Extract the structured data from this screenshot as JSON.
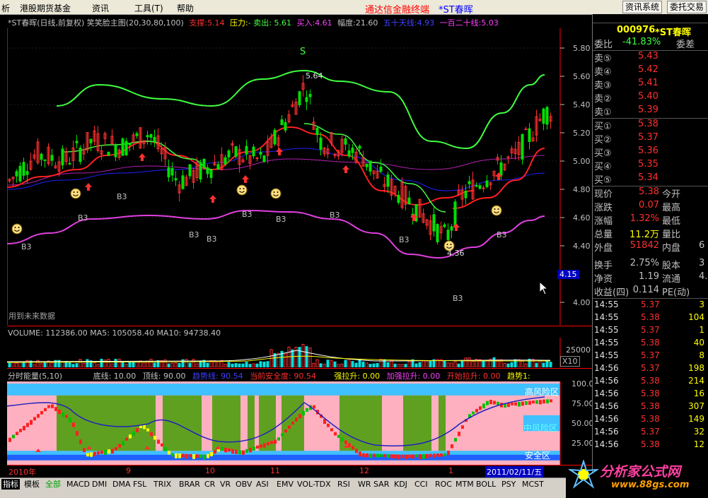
{
  "menubar": {
    "items": [
      "析",
      "港股期货基金",
      "资讯",
      "工具(T)",
      "帮助"
    ],
    "brand": "通达信金融终端",
    "stock_title": "*ST春晖",
    "btn_news": "资讯系统",
    "btn_trade": "委托交易"
  },
  "main_chart": {
    "title": "*ST春晖(日线,前复权) 笑笑脸主图(20,30,80,100)",
    "support_label": "支撑:",
    "support_value": "5.14",
    "pressure_label": "压力:",
    "pressure_value": "- 卖出: 5.61",
    "buy_label": "买入:",
    "buy_value": "4.61",
    "amplitude_label": "幅度:",
    "amplitude_value": "21.60",
    "ma50_label": "五十天线:",
    "ma50_value": "4.93",
    "ma120_label": "一百二十线:",
    "ma120_value": "5.03",
    "y_ticks": [
      "5.80",
      "5.60",
      "5.40",
      "5.20",
      "5.00",
      "4.80",
      "4.60",
      "4.40",
      "4.00"
    ],
    "price_marker": "4.15",
    "high_label": "5.64",
    "low_label": "4.36",
    "s_label": "S",
    "b3_label": "B3",
    "future_note": "用到未来数据"
  },
  "volume": {
    "text": "VOLUME: 112386.00  MA5: 105058.40  MA10: 94738.40",
    "tick": "25000",
    "multiplier": "X10"
  },
  "energy": {
    "title": "分时能量(5,10)",
    "base": "底线: 10.00",
    "top": "顶线: 90.00",
    "trend": "趋势线: 90.54",
    "safety": "当前安全度: 90.54",
    "strong": "强拉升: 0.00",
    "accel": "加强拉升: 0.00",
    "start": "开始拉升: 0.00",
    "trend1": "趋势1:",
    "y_ticks": [
      "100.0",
      "75.00",
      "50.00",
      "25.00"
    ],
    "zones": [
      "高风险区",
      "中风险区",
      "安全区"
    ]
  },
  "xaxis": {
    "labels": [
      "2010年",
      "9",
      "10",
      "11",
      "12",
      "1"
    ],
    "date": "2011/02/11/五"
  },
  "quote": {
    "code": "000976",
    "name": "*ST春晖",
    "weibi_label": "委比",
    "weibi_value": "-41.83%",
    "weicha_label": "委差",
    "sells": [
      {
        "label": "卖⑤",
        "price": "5.43"
      },
      {
        "label": "卖④",
        "price": "5.42"
      },
      {
        "label": "卖③",
        "price": "5.41"
      },
      {
        "label": "卖②",
        "price": "5.40"
      },
      {
        "label": "卖①",
        "price": "5.39"
      }
    ],
    "buys": [
      {
        "label": "买①",
        "price": "5.38"
      },
      {
        "label": "买②",
        "price": "5.37"
      },
      {
        "label": "买③",
        "price": "5.36"
      },
      {
        "label": "买④",
        "price": "5.35"
      },
      {
        "label": "买⑤",
        "price": "5.34"
      }
    ],
    "stats": [
      {
        "l1": "现价",
        "v1": "5.38",
        "l2": "今开"
      },
      {
        "l1": "涨跌",
        "v1": "0.07",
        "l2": "最高"
      },
      {
        "l1": "涨幅",
        "v1": "1.32%",
        "l2": "最低"
      },
      {
        "l1": "总量",
        "v1": "11.2万",
        "l2": "量比"
      },
      {
        "l1": "外盘",
        "v1": "51842",
        "l2": "内盘",
        "v2": "6"
      },
      {
        "l1": "换手",
        "v1": "2.75%",
        "l2": "股本",
        "v2": "3"
      },
      {
        "l1": "净资",
        "v1": "1.19",
        "l2": "流通",
        "v2": "4."
      },
      {
        "l1": "收益(四)",
        "v1": "0.114",
        "l2": "PE(动)"
      }
    ],
    "ticks": [
      {
        "t": "14:55",
        "p": "5.37",
        "v": "3"
      },
      {
        "t": "14:55",
        "p": "5.38",
        "v": "104"
      },
      {
        "t": "14:55",
        "p": "5.37",
        "v": "1"
      },
      {
        "t": "14:55",
        "p": "5.38",
        "v": "40"
      },
      {
        "t": "14:55",
        "p": "5.37",
        "v": "8"
      },
      {
        "t": "14:56",
        "p": "5.37",
        "v": "198"
      },
      {
        "t": "14:56",
        "p": "5.38",
        "v": "214"
      },
      {
        "t": "14:56",
        "p": "5.38",
        "v": "16"
      },
      {
        "t": "14:56",
        "p": "5.38",
        "v": "307"
      },
      {
        "t": "14:56",
        "p": "5.38",
        "v": "149"
      },
      {
        "t": "14:56",
        "p": "5.37",
        "v": "32"
      },
      {
        "t": "14:56",
        "p": "5.38",
        "v": "12"
      }
    ]
  },
  "tabs": [
    "指标",
    "模板",
    "全部",
    "MACD",
    "DMI",
    "DMA",
    "FSL",
    "TRIX",
    "BRAR",
    "CR",
    "VR",
    "OBV",
    "ASI",
    "EMV",
    "VOL-TDX",
    "RSI",
    "WR",
    "SAR",
    "KDJ",
    "CCI",
    "ROC",
    "MTM",
    "BOLL",
    "PSY",
    "MCST"
  ],
  "watermark": {
    "name": "分析家公式网",
    "url": "www.88gs.com"
  },
  "colors": {
    "up": "#ff3030",
    "down": "#00e000",
    "ma_green": "#40ff40",
    "band": "#e040e0",
    "blue": "#4040ff"
  }
}
